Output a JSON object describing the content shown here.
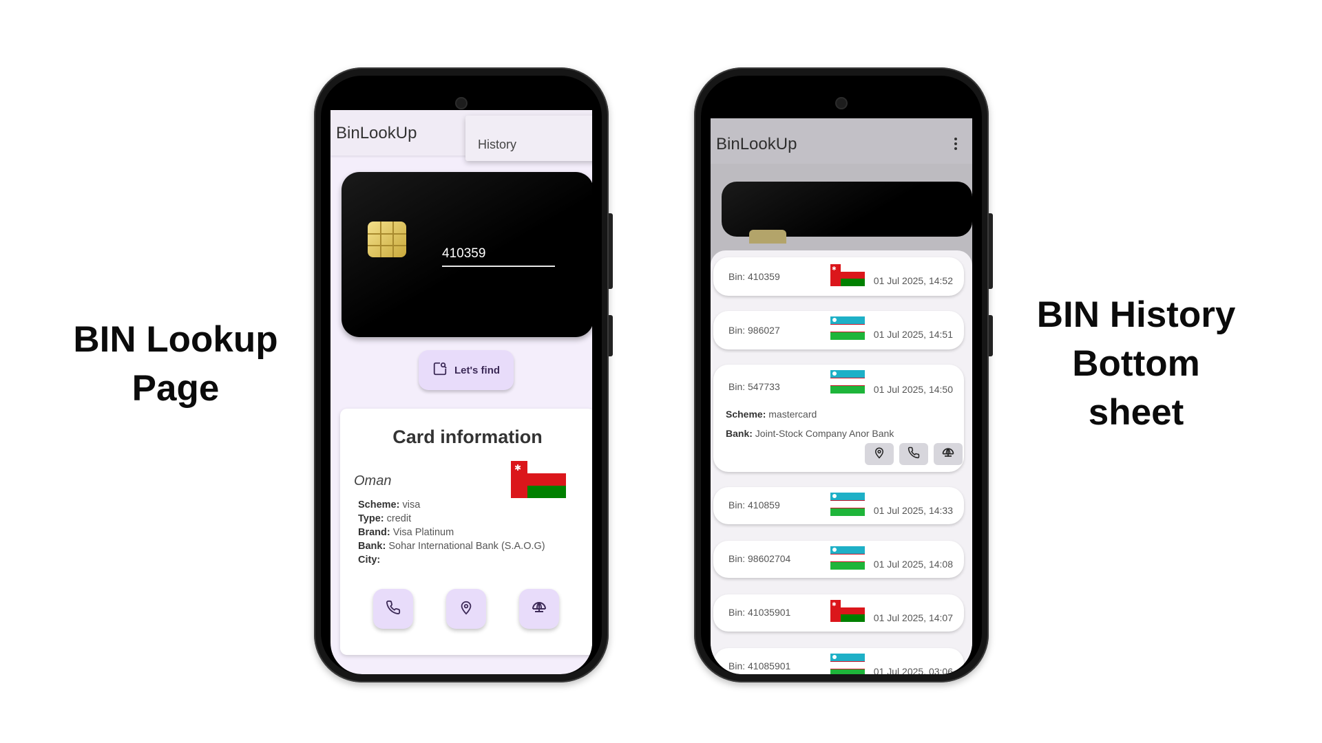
{
  "captions": {
    "left": [
      "BIN Lookup",
      "Page"
    ],
    "right": [
      "BIN History",
      "Bottom",
      "sheet"
    ]
  },
  "lookup_screen": {
    "app_title": "BinLookUp",
    "overflow_menu": {
      "items": [
        "History"
      ]
    },
    "card": {
      "bin_value": "410359"
    },
    "find_button": {
      "label": "Let's find",
      "icon": "search-page-icon"
    },
    "card_info": {
      "heading": "Card information",
      "country": "Oman",
      "flag": "oman",
      "details": [
        {
          "label": "Scheme:",
          "value": "visa"
        },
        {
          "label": "Type:",
          "value": "credit"
        },
        {
          "label": "Brand:",
          "value": "Visa Platinum"
        },
        {
          "label": "Bank:",
          "value": "Sohar International Bank (S.A.O.G)"
        },
        {
          "label": "City:",
          "value": ""
        }
      ],
      "actions": [
        "phone-icon",
        "location-pin-icon",
        "globe-icon"
      ]
    }
  },
  "history_screen": {
    "app_title": "BinLookUp",
    "items": [
      {
        "bin": "Bin: 410359",
        "flag": "oman",
        "time": "01 Jul 2025, 14:52"
      },
      {
        "bin": "Bin: 986027",
        "flag": "uzbekistan",
        "time": "01 Jul 2025, 14:51"
      },
      {
        "bin": "Bin: 547733",
        "flag": "uzbekistan",
        "time": "01 Jul 2025, 14:50",
        "expanded": {
          "scheme_label": "Scheme:",
          "scheme": "mastercard",
          "bank_label": "Bank:",
          "bank": "Joint-Stock Company Anor Bank"
        }
      },
      {
        "bin": "Bin: 410859",
        "flag": "uzbekistan",
        "time": "01 Jul 2025, 14:33"
      },
      {
        "bin": "Bin: 98602704",
        "flag": "uzbekistan",
        "time": "01 Jul 2025, 14:08"
      },
      {
        "bin": "Bin: 41035901",
        "flag": "oman",
        "time": "01 Jul 2025, 14:07"
      },
      {
        "bin": "Bin: 41085901",
        "flag": "uzbekistan",
        "time": "01 Jul 2025, 03:06"
      }
    ]
  },
  "colors": {
    "accent_button": "#e8dcfa",
    "oman_red": "#db161b",
    "oman_green": "#008000",
    "uz_blue": "#1eb0c7",
    "uz_green": "#1eb53a"
  }
}
